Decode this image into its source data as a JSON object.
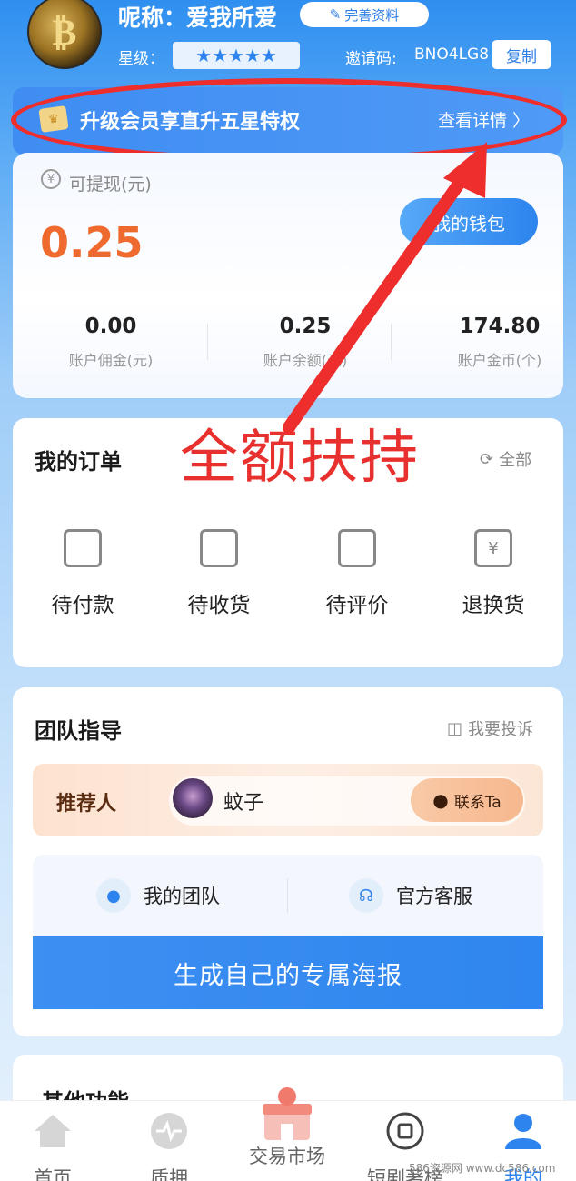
{
  "profile": {
    "nickname": "呢称：爱我所爱",
    "edit_label": "完善资料",
    "star_label": "星级：",
    "stars": "★★★★★",
    "invite_label": "邀请码:",
    "invite_code": "BNO4LG8",
    "copy_label": "复制"
  },
  "banner": {
    "title": "升级会员享直升五星特权",
    "link": "查看详情 〉"
  },
  "wallet": {
    "withdraw_label": "可提现(元)",
    "amount": "0.25",
    "button": "我的钱包",
    "stats": [
      {
        "value": "0.00",
        "label": "账户佣金(元)"
      },
      {
        "value": "0.25",
        "label": "账户余额(元)"
      },
      {
        "value": "174.80",
        "label": "账户金币(个)"
      }
    ]
  },
  "overlay": {
    "text": "全额扶持"
  },
  "orders": {
    "title": "我的订单",
    "all_label": "全部",
    "items": [
      {
        "label": "待付款",
        "icon": "wallet-icon"
      },
      {
        "label": "待收货",
        "icon": "inbox-icon"
      },
      {
        "label": "待评价",
        "icon": "box-icon"
      },
      {
        "label": "退换货",
        "icon": "refund-icon"
      }
    ]
  },
  "team": {
    "title": "团队指导",
    "complaint_label": "我要投诉",
    "referrer_label": "推荐人",
    "referrer_name": "蚊子",
    "contact_label": "联系Ta",
    "my_team": "我的团队",
    "service": "官方客服",
    "poster_button": "生成自己的专属海报"
  },
  "other": {
    "title": "其他功能"
  },
  "nav": {
    "items": [
      {
        "label": "首页",
        "icon": "home-icon"
      },
      {
        "label": "质押",
        "icon": "pulse-icon"
      },
      {
        "label": "交易市场",
        "icon": "store-icon"
      },
      {
        "label": "短剧著榜",
        "icon": "square-icon"
      },
      {
        "label": "我的",
        "icon": "user-icon"
      }
    ],
    "active": "我的"
  },
  "watermark": "586资源网 www.dc586.com",
  "colors": {
    "accent": "#2e84ee",
    "amount": "#ef6a2f",
    "annotation": "#e8312f"
  }
}
